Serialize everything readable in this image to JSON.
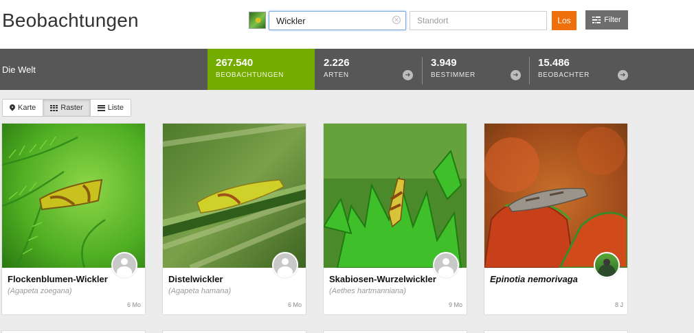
{
  "header": {
    "title": "Beobachtungen",
    "search_value": "Wickler",
    "location_placeholder": "Standort",
    "go_label": "Los",
    "filter_label": "Filter"
  },
  "statsbar": {
    "place": "Die Welt",
    "stats": [
      {
        "number": "267.540",
        "label": "BEOBACHTUNGEN"
      },
      {
        "number": "2.226",
        "label": "ARTEN"
      },
      {
        "number": "3.949",
        "label": "BESTIMMER"
      },
      {
        "number": "15.486",
        "label": "BEOBACHTER"
      }
    ]
  },
  "views": {
    "map": "Karte",
    "grid": "Raster",
    "list": "Liste",
    "active": "grid"
  },
  "observations": [
    {
      "common_name": "Flockenblumen-Wickler",
      "scientific_name": "(Agapeta zoegana)",
      "age": "6 Mo"
    },
    {
      "common_name": "Distelwickler",
      "scientific_name": "(Agapeta hamana)",
      "age": "6 Mo"
    },
    {
      "common_name": "Skabiosen-Wurzelwickler",
      "scientific_name": "(Aethes hartmanniana)",
      "age": "9 Mo"
    },
    {
      "common_name": "Epinotia nemorivaga",
      "scientific_name": "",
      "age": "8 J"
    }
  ],
  "colors": {
    "active_stat": "#74ac00",
    "statsbar": "#575757",
    "go_button": "#f06f0d",
    "filter_button": "#6d6d6d"
  }
}
